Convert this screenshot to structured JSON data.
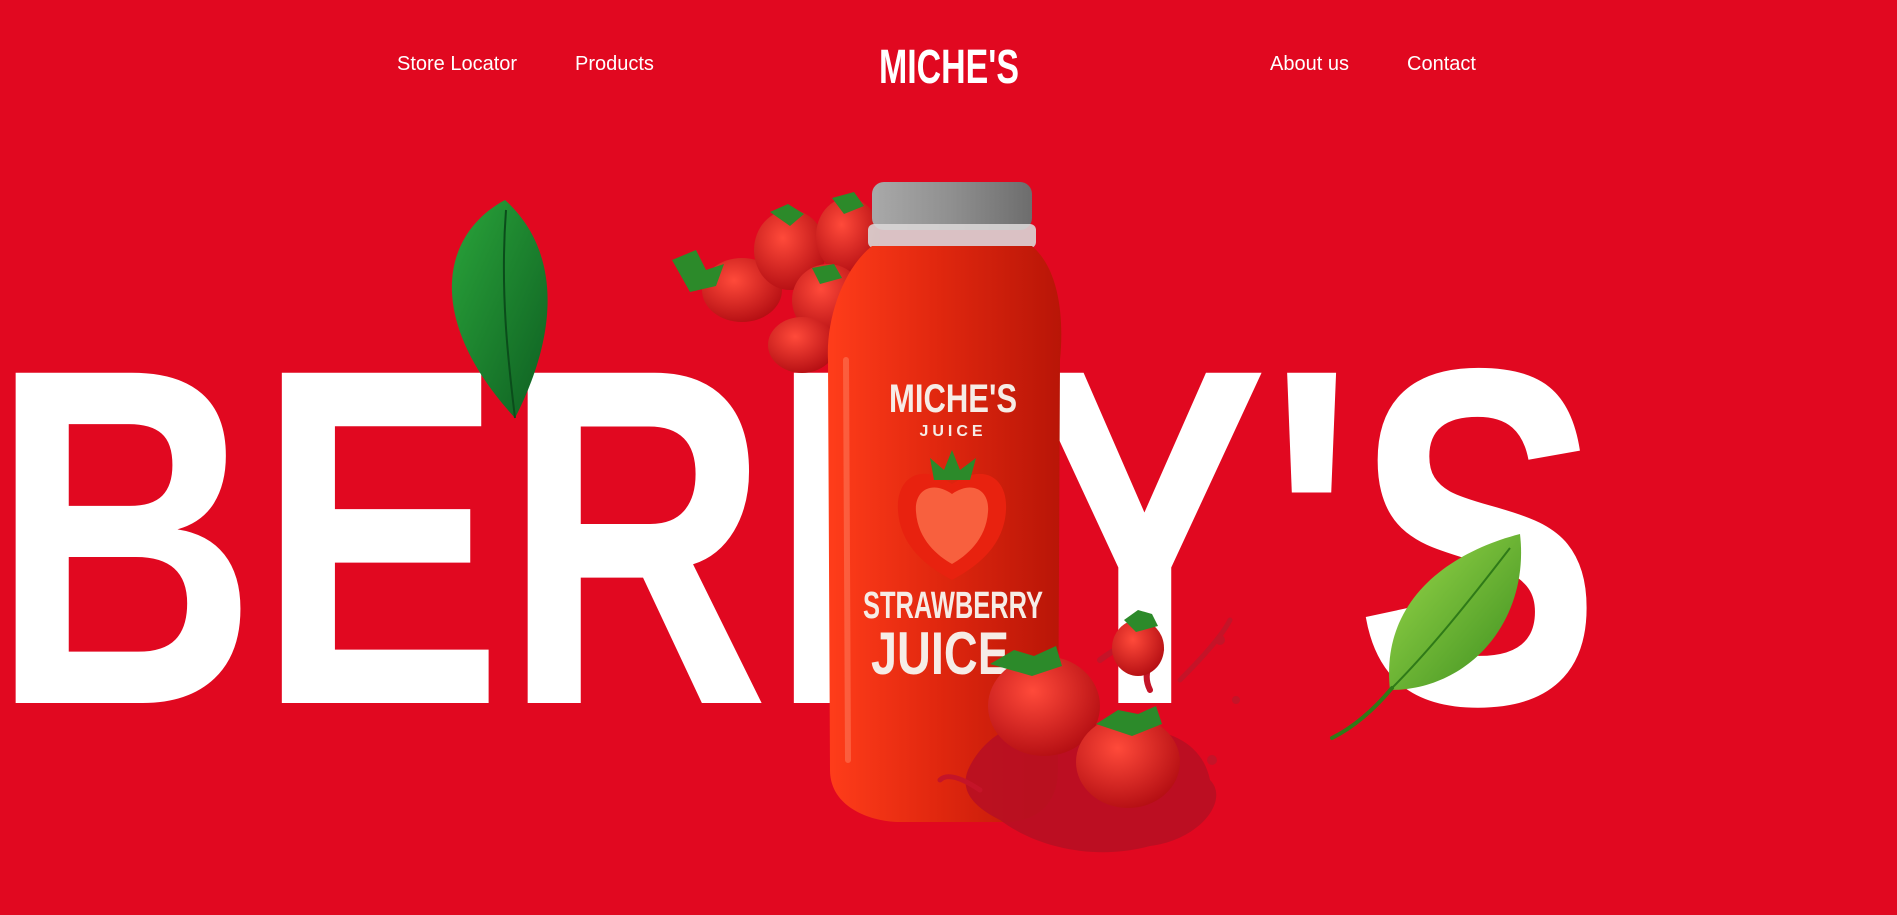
{
  "nav": {
    "left_links": [
      {
        "label": "Store Locator"
      },
      {
        "label": "Products"
      }
    ],
    "right_links": [
      {
        "label": "About us"
      },
      {
        "label": "Contact"
      }
    ],
    "logo_text": "MICHE'S"
  },
  "hero": {
    "headline": "BERRY'S",
    "bottle": {
      "brand": "MICHE'S",
      "brand_sub": "JUICE",
      "flavor": "STRAWBERRY",
      "product": "JUICE"
    }
  },
  "colors": {
    "background": "#e10820",
    "text": "#ffffff",
    "juice": "#e2280f",
    "cap": "#8f8f8f",
    "leaf_dark": "#1f8a2f",
    "leaf_light": "#7cc43a"
  },
  "icons": {
    "logo": "miches-wordmark",
    "decor_top_left": "strawberry-cluster",
    "decor_bottom": "strawberry-splash",
    "leaves": "basil-leaf"
  }
}
